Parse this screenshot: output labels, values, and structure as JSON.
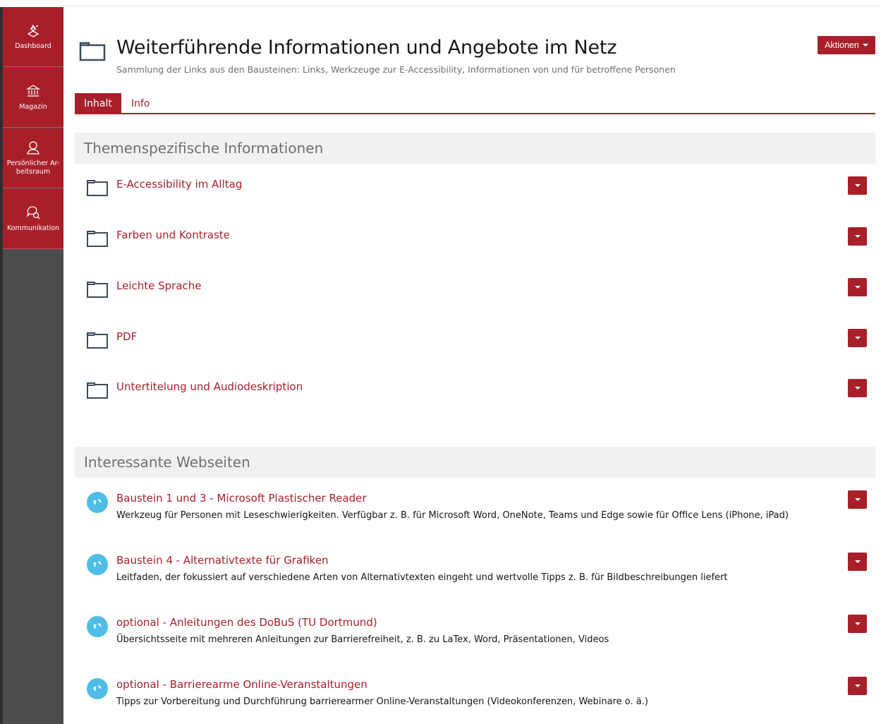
{
  "sidebar": {
    "items": [
      {
        "label": "Dashboard",
        "icon": "dashboard-icon"
      },
      {
        "label": "Magazin",
        "icon": "bank-icon"
      },
      {
        "label": "Persönlicher Ar-beitsraum",
        "icon": "user-icon"
      },
      {
        "label": "Kommunikation",
        "icon": "chat-icon"
      }
    ]
  },
  "header": {
    "title": "Weiterführende Informationen und Angebote im Netz",
    "description": "Sammlung der Links aus den Bausteinen: Links, Werkzeuge zur E-Accessibility, Informationen von und für betroffene Personen",
    "actions_label": "Aktionen"
  },
  "tabs": [
    {
      "label": "Inhalt",
      "active": true
    },
    {
      "label": "Info",
      "active": false
    }
  ],
  "sections": [
    {
      "title": "Themenspezifische Informationen",
      "items": [
        {
          "title": "E-Accessibility im Alltag"
        },
        {
          "title": "Farben und Kontraste"
        },
        {
          "title": "Leichte Sprache"
        },
        {
          "title": "PDF"
        },
        {
          "title": "Untertitelung und Audiodeskription"
        }
      ]
    },
    {
      "title": "Interessante Webseiten",
      "items": [
        {
          "title": "Baustein 1 und 3 - Microsoft Plastischer Reader",
          "description": "Werkzeug für Personen mit Leseschwierigkeiten. Verfügbar z. B. für Microsoft Word, OneNote, Teams und Edge sowie für Office Lens (iPhone, iPad)"
        },
        {
          "title": "Baustein 4 - Alternativtexte für Grafiken",
          "description": "Leitfaden, der fokussiert auf verschiedene Arten von Alternativtexten eingeht und wertvolle Tipps z. B. für Bildbeschreibungen liefert"
        },
        {
          "title": "optional - Anleitungen des DoBuS (TU Dortmund)",
          "description": "Übersichtsseite mit mehreren Anleitungen zur Barrierefreiheit, z. B. zu LaTex, Word, Präsentationen, Videos"
        },
        {
          "title": "optional - Barrierearme Online-Veranstaltungen",
          "description": "Tipps zur Vorbereitung und Durchführung barrierearmer Online-Veranstaltungen (Videokonferenzen, Webinare o. ä.)"
        }
      ]
    }
  ],
  "colors": {
    "accent": "#a81f2a",
    "sidebar": "#4c4c4c",
    "section_bg": "#f1f1f1",
    "weblink_icon": "#4fbde6"
  }
}
